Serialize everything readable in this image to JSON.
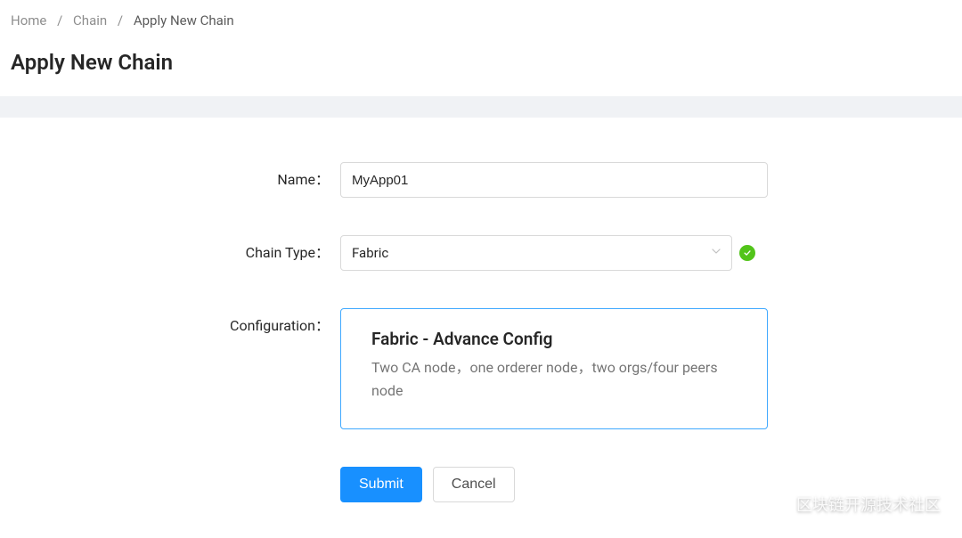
{
  "breadcrumb": {
    "items": [
      {
        "label": "Home"
      },
      {
        "label": "Chain"
      },
      {
        "label": "Apply New Chain"
      }
    ]
  },
  "page": {
    "title": "Apply New Chain"
  },
  "form": {
    "name": {
      "label": "Name：",
      "value": "MyApp01"
    },
    "chain_type": {
      "label": "Chain Type：",
      "value": "Fabric",
      "validated": true
    },
    "configuration": {
      "label": "Configuration：",
      "card_title": "Fabric - Advance Config",
      "card_desc": "Two CA node，one orderer node，two orgs/four peers node"
    },
    "buttons": {
      "submit": "Submit",
      "cancel": "Cancel"
    }
  },
  "watermark": {
    "text": "区块链开源技术社区"
  }
}
